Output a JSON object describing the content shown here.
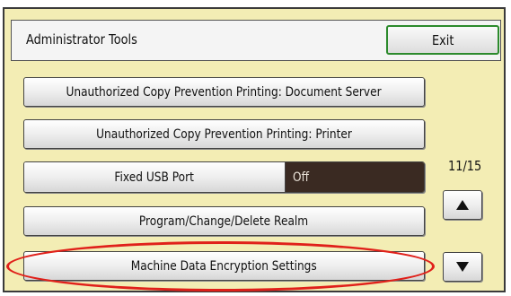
{
  "header": {
    "title": "Administrator Tools",
    "exit_label": "Exit"
  },
  "menu": {
    "items": [
      {
        "label": "Unauthorized Copy Prevention Printing: Document Server"
      },
      {
        "label": "Unauthorized Copy Prevention Printing: Printer"
      },
      {
        "label": "Fixed USB Port",
        "value": "Off"
      },
      {
        "label": "Program/Change/Delete Realm"
      },
      {
        "label": "Machine Data Encryption Settings"
      }
    ]
  },
  "pagination": {
    "indicator": "11/15",
    "up_icon": "arrow-up-icon",
    "down_icon": "arrow-down-icon"
  },
  "colors": {
    "panel_background": "#f3edb4",
    "exit_border": "#2c8a2c",
    "value_background": "#3a2a22",
    "highlight": "#e0201a"
  }
}
